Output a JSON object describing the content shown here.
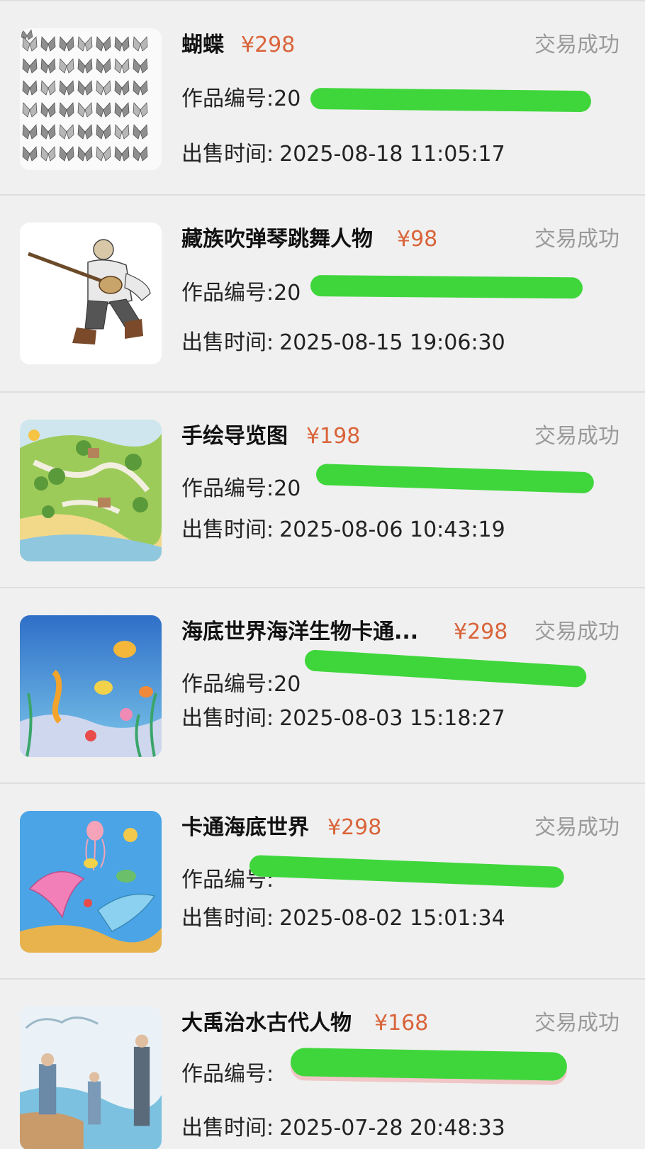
{
  "colors": {
    "price": "#d9643a",
    "status": "#9a9a9a",
    "redaction": "#3fd63c",
    "background": "#f0f0f0"
  },
  "labels": {
    "serial": "作品编号:",
    "sold_time": "出售时间:"
  },
  "items": [
    {
      "title": "蝴蝶",
      "price": "¥298",
      "status": "交易成功",
      "serial_visible": "20",
      "sold_time": "2025-08-18 11:05:17",
      "thumbnail_icon": "butterflies-image"
    },
    {
      "title": "藏族吹弹琴跳舞人物",
      "price": "¥98",
      "status": "交易成功",
      "serial_visible": "20",
      "sold_time": "2025-08-15 19:06:30",
      "thumbnail_icon": "tibetan-musician-image"
    },
    {
      "title": "手绘导览图",
      "price": "¥198",
      "status": "交易成功",
      "serial_visible": "20",
      "sold_time": "2025-08-06 10:43:19",
      "thumbnail_icon": "guide-map-image"
    },
    {
      "title": "海底世界海洋生物卡通...",
      "price": "¥298",
      "status": "交易成功",
      "serial_visible": "20",
      "sold_time": "2025-08-03 15:18:27",
      "thumbnail_icon": "sea-creatures-image"
    },
    {
      "title": "卡通海底世界",
      "price": "¥298",
      "status": "交易成功",
      "serial_visible": "",
      "sold_time": "2025-08-02 15:01:34",
      "thumbnail_icon": "cartoon-dolphins-image"
    },
    {
      "title": "大禹治水古代人物",
      "price": "¥168",
      "status": "交易成功",
      "serial_visible": "",
      "sold_time": "2025-07-28 20:48:33",
      "thumbnail_icon": "ancient-figures-image"
    }
  ]
}
